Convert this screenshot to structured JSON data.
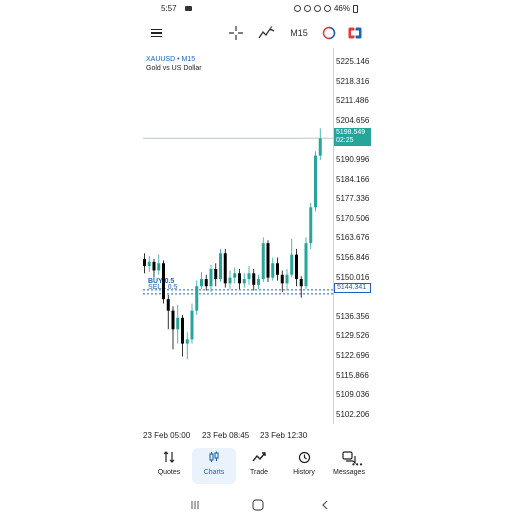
{
  "status_bar": {
    "time": "5:57",
    "battery": "46%"
  },
  "toolbar": {
    "timeframe": "M15"
  },
  "chart": {
    "symbol": "XAUUSD • M15",
    "description": "Gold vs US Dollar",
    "price_labels": [
      "5225.146",
      "5218.316",
      "5211.486",
      "5204.656",
      "5190.996",
      "5184.166",
      "5177.336",
      "5170.506",
      "5163.676",
      "5156.846",
      "5150.016",
      "5136.356",
      "5129.526",
      "5122.696",
      "5115.866",
      "5109.036",
      "5102.206"
    ],
    "ask_price": "5198.549",
    "ask_timer": "02:25",
    "bid_price": "5144.341",
    "buy_label": "BUY 0.5",
    "sell_label": "SELL 0.5",
    "time_labels": [
      "23 Feb 05:00",
      "23 Feb 08:45",
      "23 Feb 12:30"
    ],
    "more_dots": "•••",
    "colors": {
      "bull": "#26a69a",
      "bear": "#000000",
      "ask_line": "#26a69a",
      "bid_line": "#1e63b4"
    }
  },
  "chart_data": {
    "type": "candlestick",
    "symbol": "XAUUSD",
    "timeframe": "M15",
    "ylim": [
      5099,
      5230
    ],
    "candles": [
      {
        "o": 5156.5,
        "c": 5154.0,
        "h": 5158.5,
        "l": 5151.5
      },
      {
        "o": 5154.0,
        "c": 5155.5,
        "h": 5157.5,
        "l": 5152.0
      },
      {
        "o": 5155.5,
        "c": 5152.5,
        "h": 5156.5,
        "l": 5150.0
      },
      {
        "o": 5152.5,
        "c": 5155.0,
        "h": 5158.0,
        "l": 5151.0
      },
      {
        "o": 5155.0,
        "c": 5142.5,
        "h": 5156.0,
        "l": 5141.0
      },
      {
        "o": 5142.5,
        "c": 5138.5,
        "h": 5144.0,
        "l": 5132.0
      },
      {
        "o": 5138.5,
        "c": 5132.0,
        "h": 5140.0,
        "l": 5125.0
      },
      {
        "o": 5132.0,
        "c": 5136.0,
        "h": 5140.5,
        "l": 5127.0
      },
      {
        "o": 5136.0,
        "c": 5127.0,
        "h": 5137.0,
        "l": 5122.5
      },
      {
        "o": 5127.0,
        "c": 5128.5,
        "h": 5131.0,
        "l": 5121.5
      },
      {
        "o": 5128.5,
        "c": 5138.5,
        "h": 5141.0,
        "l": 5127.0
      },
      {
        "o": 5138.5,
        "c": 5147.0,
        "h": 5149.0,
        "l": 5137.0
      },
      {
        "o": 5147.0,
        "c": 5149.5,
        "h": 5152.0,
        "l": 5146.0
      },
      {
        "o": 5149.5,
        "c": 5147.0,
        "h": 5151.0,
        "l": 5145.5
      },
      {
        "o": 5147.0,
        "c": 5153.0,
        "h": 5154.5,
        "l": 5145.0
      },
      {
        "o": 5153.0,
        "c": 5149.5,
        "h": 5155.0,
        "l": 5147.0
      },
      {
        "o": 5149.5,
        "c": 5158.5,
        "h": 5160.0,
        "l": 5148.5
      },
      {
        "o": 5158.5,
        "c": 5148.0,
        "h": 5160.0,
        "l": 5146.5
      },
      {
        "o": 5148.0,
        "c": 5150.0,
        "h": 5152.5,
        "l": 5146.0
      },
      {
        "o": 5150.0,
        "c": 5151.5,
        "h": 5153.5,
        "l": 5148.0
      },
      {
        "o": 5151.5,
        "c": 5148.0,
        "h": 5153.0,
        "l": 5146.0
      },
      {
        "o": 5148.0,
        "c": 5149.5,
        "h": 5151.5,
        "l": 5146.5
      },
      {
        "o": 5149.5,
        "c": 5151.5,
        "h": 5154.0,
        "l": 5147.5
      },
      {
        "o": 5151.5,
        "c": 5147.5,
        "h": 5153.0,
        "l": 5145.5
      },
      {
        "o": 5147.5,
        "c": 5149.5,
        "h": 5151.0,
        "l": 5146.0
      },
      {
        "o": 5149.5,
        "c": 5162.0,
        "h": 5164.0,
        "l": 5148.5
      },
      {
        "o": 5162.0,
        "c": 5150.0,
        "h": 5163.0,
        "l": 5148.5
      },
      {
        "o": 5150.0,
        "c": 5155.0,
        "h": 5157.0,
        "l": 5149.0
      },
      {
        "o": 5155.0,
        "c": 5151.0,
        "h": 5157.0,
        "l": 5149.0
      },
      {
        "o": 5151.0,
        "c": 5148.0,
        "h": 5152.5,
        "l": 5145.0
      },
      {
        "o": 5148.0,
        "c": 5151.0,
        "h": 5153.0,
        "l": 5145.5
      },
      {
        "o": 5151.0,
        "c": 5158.0,
        "h": 5163.5,
        "l": 5150.0
      },
      {
        "o": 5158.0,
        "c": 5149.5,
        "h": 5160.0,
        "l": 5147.0
      },
      {
        "o": 5149.5,
        "c": 5147.0,
        "h": 5150.5,
        "l": 5143.0
      },
      {
        "o": 5147.0,
        "c": 5162.0,
        "h": 5164.0,
        "l": 5146.0
      },
      {
        "o": 5162.0,
        "c": 5174.5,
        "h": 5176.0,
        "l": 5160.0
      },
      {
        "o": 5174.5,
        "c": 5192.5,
        "h": 5194.0,
        "l": 5173.0
      },
      {
        "o": 5192.5,
        "c": 5198.5,
        "h": 5202.0,
        "l": 5191.0
      }
    ],
    "x_tick_labels": [
      "23 Feb 05:00",
      "23 Feb 08:45",
      "23 Feb 12:30"
    ],
    "ask_line": 5198.549,
    "bid_line": 5144.341
  },
  "bottom_nav": [
    {
      "label": "Quotes",
      "icon": "quotes-icon"
    },
    {
      "label": "Charts",
      "icon": "charts-icon",
      "active": true
    },
    {
      "label": "Trade",
      "icon": "trade-icon"
    },
    {
      "label": "History",
      "icon": "history-icon"
    },
    {
      "label": "Messages",
      "icon": "messages-icon"
    }
  ]
}
